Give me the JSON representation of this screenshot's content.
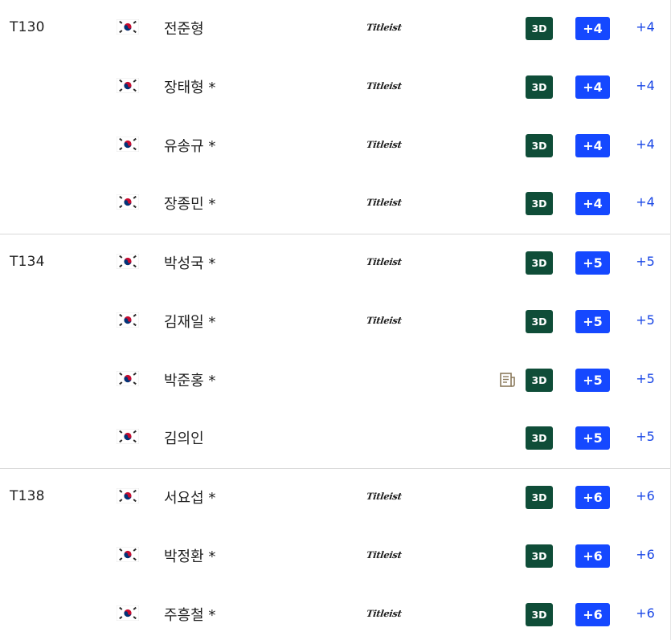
{
  "colors": {
    "three_d_button": "#0f4d38",
    "score_badge": "#1548ff",
    "total_text": "#1a47e6",
    "divider": "#d9d9d9"
  },
  "groups": [
    {
      "position": "T130",
      "players": [
        {
          "name": "전준형",
          "equipment": "Titleist",
          "three_d": "3D",
          "score": "+4",
          "total": "+4",
          "news": false
        },
        {
          "name": "장태형 *",
          "equipment": "Titleist",
          "three_d": "3D",
          "score": "+4",
          "total": "+4",
          "news": false
        },
        {
          "name": "유송규 *",
          "equipment": "Titleist",
          "three_d": "3D",
          "score": "+4",
          "total": "+4",
          "news": false
        },
        {
          "name": "장종민 *",
          "equipment": "Titleist",
          "three_d": "3D",
          "score": "+4",
          "total": "+4",
          "news": false
        }
      ]
    },
    {
      "position": "T134",
      "players": [
        {
          "name": "박성국 *",
          "equipment": "Titleist",
          "three_d": "3D",
          "score": "+5",
          "total": "+5",
          "news": false
        },
        {
          "name": "김재일 *",
          "equipment": "Titleist",
          "three_d": "3D",
          "score": "+5",
          "total": "+5",
          "news": false
        },
        {
          "name": "박준홍 *",
          "equipment": "",
          "three_d": "3D",
          "score": "+5",
          "total": "+5",
          "news": true
        },
        {
          "name": "김의인",
          "equipment": "",
          "three_d": "3D",
          "score": "+5",
          "total": "+5",
          "news": false
        }
      ]
    },
    {
      "position": "T138",
      "players": [
        {
          "name": "서요섭 *",
          "equipment": "Titleist",
          "three_d": "3D",
          "score": "+6",
          "total": "+6",
          "news": false
        },
        {
          "name": "박정환 *",
          "equipment": "Titleist",
          "three_d": "3D",
          "score": "+6",
          "total": "+6",
          "news": false
        },
        {
          "name": "주흥철 *",
          "equipment": "Titleist",
          "three_d": "3D",
          "score": "+6",
          "total": "+6",
          "news": false
        }
      ]
    }
  ],
  "icons": {
    "flag": "korea-flag-icon",
    "news": "news-article-icon"
  }
}
